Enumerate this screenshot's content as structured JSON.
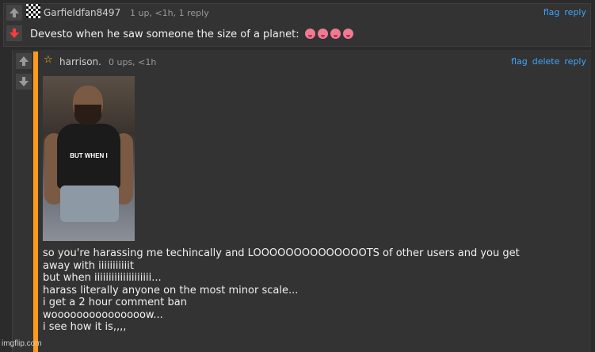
{
  "comment1": {
    "username": "Garfieldfan8497",
    "meta": "1 up, <1h, 1 reply",
    "links": [
      "flag",
      "reply"
    ],
    "text": "Devesto when he saw someone the size of a planet:",
    "emoji_count": 4,
    "vote_state": "downvoted",
    "accent_down": "#ff3b3b"
  },
  "comment2": {
    "username": "harrison.",
    "meta": "0 ups, <1h",
    "links": [
      "flag",
      "delete",
      "reply"
    ],
    "image_caption": "BUT WHEN I",
    "lines": [
      "so you're harassing me techincally and LOOOOOOOOOOOOOOTS of other users and you get",
      "away with iiiiiiiiiiit",
      "but when iiiiiiiiiiiiiiiiiiii...",
      "harass literally anyone on the most minor scale...",
      "i get a 2 hour comment ban",
      "wooooooooooooooow...",
      "i see how it is,,,,"
    ],
    "accent": "#ff9a1f"
  },
  "watermark": "imgflip.com"
}
